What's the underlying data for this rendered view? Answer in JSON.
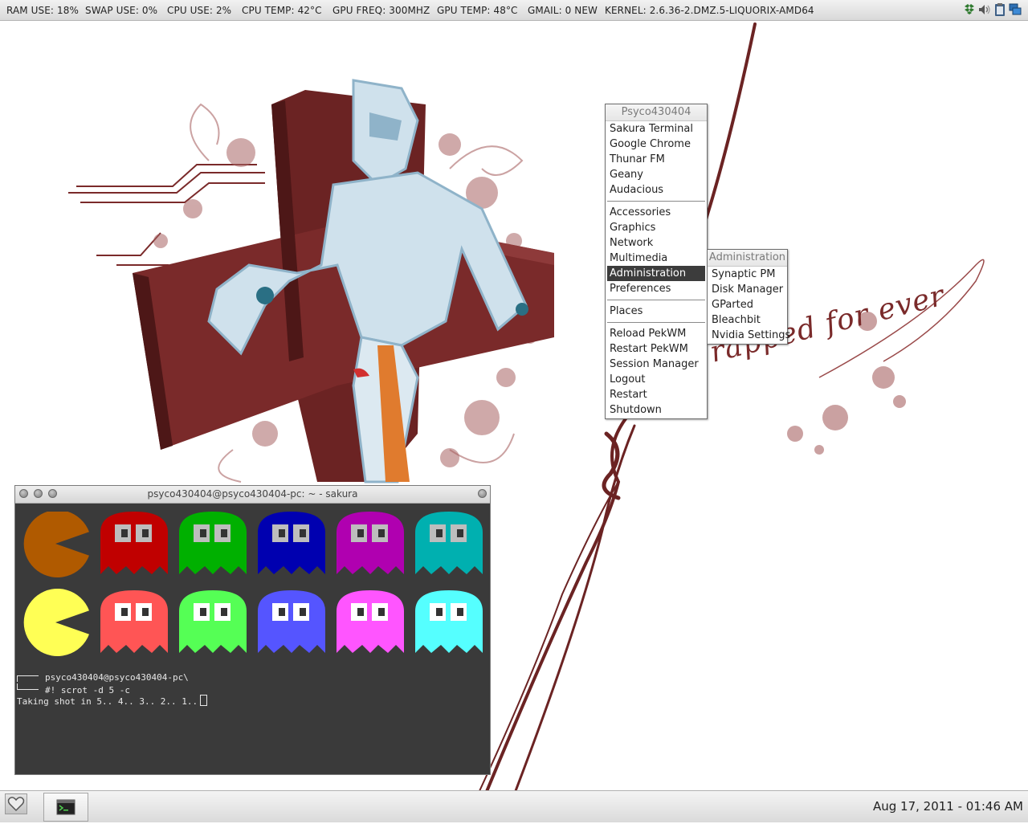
{
  "status_bar": {
    "ram": "RAM USE: 18%",
    "swap": "SWAP USE: 0%",
    "cpu_use": "CPU USE: 2%",
    "cpu_temp": "CPU TEMP: 42°C",
    "gpu_freq": "GPU FREQ: 300MHZ",
    "gpu_temp": "GPU TEMP: 48°C",
    "gmail": "GMAIL: 0 NEW",
    "kernel": "KERNEL: 2.6.36-2.DMZ.5-LIQUORIX-AMD64",
    "tray_icons": [
      "dropbox-icon",
      "volume-icon",
      "clipboard-icon",
      "network-icon"
    ]
  },
  "wallpaper": {
    "caption": "rapped for ever",
    "colors": {
      "maroon": "#7a2a2a",
      "light_blue": "#b9d3e3",
      "orange": "#e07b2e"
    }
  },
  "root_menu": {
    "title": "Psyco430404",
    "apps": [
      "Sakura Terminal",
      "Google Chrome",
      "Thunar FM",
      "Geany",
      "Audacious"
    ],
    "categories": [
      "Accessories",
      "Graphics",
      "Network",
      "Multimedia",
      "Administration",
      "Preferences"
    ],
    "active_category": "Administration",
    "places": [
      "Places"
    ],
    "session": [
      "Reload PekWM",
      "Restart PekWM",
      "Session Manager",
      "Logout",
      "Restart",
      "Shutdown"
    ]
  },
  "sub_menu": {
    "title": "Administration",
    "items": [
      "Synaptic PM",
      "Disk Manager",
      "GParted",
      "Bleachbit",
      "Nvidia Settings"
    ]
  },
  "terminal": {
    "title": "psyco430404@psyco430404-pc: ~ - sakura",
    "line1": "psyco430404@psyco430404-pc\\",
    "line2": "#! scrot -d 5 -c",
    "line3": "Taking shot in 5.. 4.. 3.. 2.. 1..",
    "palette_row1": [
      "#b05a00",
      "#c00000",
      "#00b000",
      "#0000b0",
      "#b000b0",
      "#00b0b0"
    ],
    "palette_row2": [
      "#ffff55",
      "#ff5555",
      "#55ff55",
      "#5555ff",
      "#ff55ff",
      "#55ffff"
    ]
  },
  "taskbar": {
    "clock": "Aug 17, 2011 - 01:46 AM",
    "task_icon": "terminal-icon",
    "start_icon": "heart-icon"
  }
}
